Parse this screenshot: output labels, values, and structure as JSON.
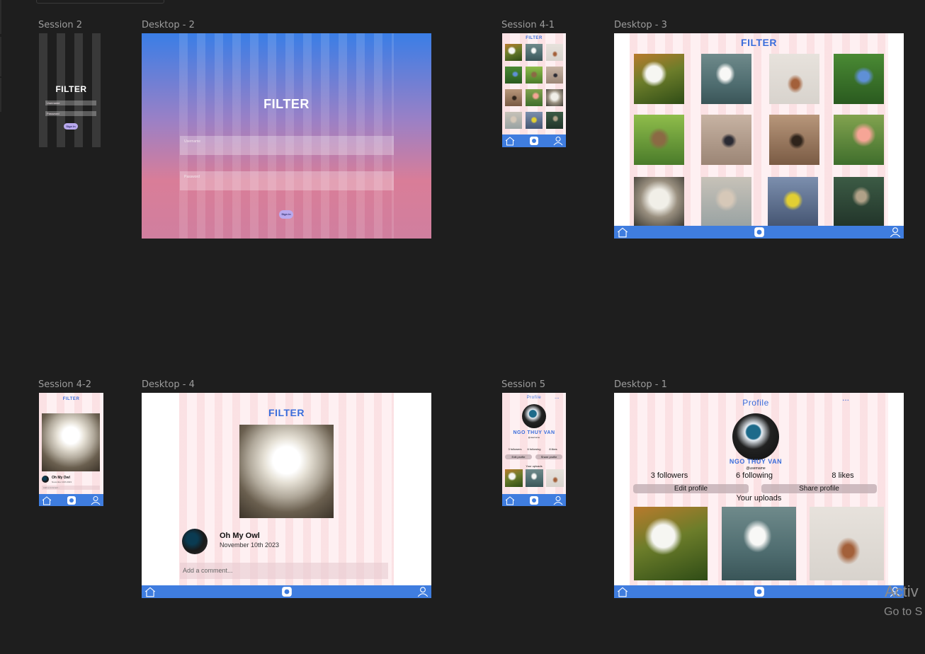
{
  "frames": {
    "session2": {
      "label": "Session 2",
      "brand": "FILTER",
      "username_placeholder": "Username",
      "password_placeholder": "Password",
      "signin": "Sign in"
    },
    "desktop2": {
      "label": "Desktop - 2",
      "brand": "FILTER",
      "username_placeholder": "Username",
      "password_placeholder": "Password",
      "signin": "Sign in"
    },
    "session41": {
      "label": "Session 4-1",
      "brand": "FILTER"
    },
    "desktop3": {
      "label": "Desktop - 3",
      "brand": "FILTER"
    },
    "session42": {
      "label": "Session 4-2",
      "brand": "FILTER",
      "post_title": "Oh My Owl",
      "post_date": "November 10th 2023",
      "comment_placeholder": "Add a comment..."
    },
    "desktop4": {
      "label": "Desktop - 4",
      "brand": "FILTER",
      "post_title": "Oh My Owl",
      "post_date": "November 10th 2023",
      "comment_placeholder": "Add a comment..."
    },
    "session5": {
      "label": "Session 5",
      "title": "Profile",
      "more": "...",
      "name": "NGO THUY VAN",
      "handle": "@username",
      "followers": "3 followers",
      "following": "6 following",
      "likes": "8 likes",
      "edit": "Edit profile",
      "share": "Share profile",
      "uploads": "Your uploads"
    },
    "desktop1": {
      "label": "Desktop - 1",
      "title": "Profile",
      "more": "...",
      "name": "NGO THUY VAN",
      "handle": "@username",
      "followers": "3 followers",
      "following": "6 following",
      "likes": "8 likes",
      "edit": "Edit profile",
      "share": "Share profile",
      "uploads": "Your uploads"
    }
  },
  "watermark": {
    "line1": "Activ",
    "line2": "Go to S"
  },
  "icons": {
    "home": "home-icon",
    "camera": "camera-icon",
    "user": "user-icon"
  },
  "colors": {
    "canvas": "#1e1e1e",
    "brand_blue": "#3f7ddf",
    "gradient_top": "#3a7ee6",
    "gradient_bottom": "#d07f9f",
    "column_pink": "#fcdde2"
  }
}
